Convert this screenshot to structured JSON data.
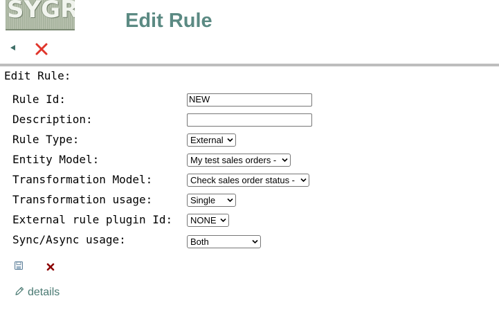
{
  "header": {
    "logo_text": "SYGR",
    "title": "Edit Rule",
    "back_icon": "back-arrow-icon",
    "close_icon": "close-icon"
  },
  "form": {
    "heading": "Edit Rule:",
    "fields": [
      {
        "label": "Rule Id:",
        "value": "NEW"
      },
      {
        "label": "Description:",
        "value": ""
      },
      {
        "label": "Rule Type:",
        "value": "External"
      },
      {
        "label": "Entity Model:",
        "value": "My test sales orders -"
      },
      {
        "label": "Transformation Model:",
        "value": "Check sales order status -"
      },
      {
        "label": "Transformation usage:",
        "value": "Single"
      },
      {
        "label": "External rule plugin Id:",
        "value": "NONE"
      },
      {
        "label": "Sync/Async usage:",
        "value": "Both"
      }
    ]
  },
  "actions": {
    "save_icon": "save-icon",
    "cancel_icon": "cancel-icon",
    "details_label": "details",
    "details_icon": "pencil-icon"
  },
  "colors": {
    "title": "#5b8a83",
    "close_red": "#e0352b",
    "cancel_dark_red": "#8b0000",
    "link": "#4a7a73"
  }
}
